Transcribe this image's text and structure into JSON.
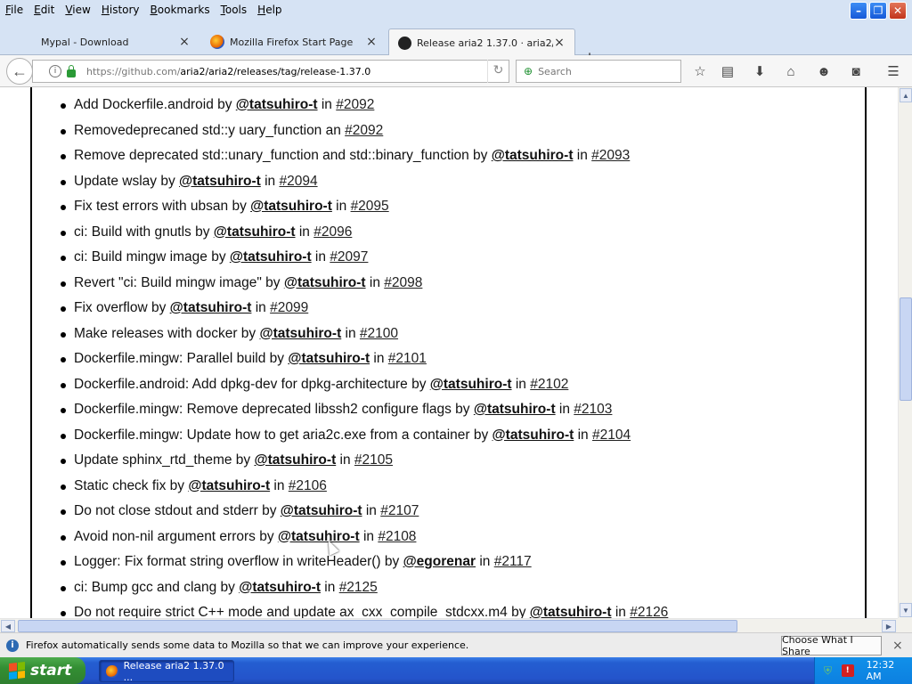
{
  "menubar": {
    "items": [
      "File",
      "Edit",
      "View",
      "History",
      "Bookmarks",
      "Tools",
      "Help"
    ]
  },
  "tabs": [
    {
      "label": "Mypal - Download",
      "close": "×"
    },
    {
      "label": "Mozilla Firefox Start Page",
      "close": "×"
    },
    {
      "label": "Release aria2 1.37.0 · aria2/...",
      "close": "×"
    }
  ],
  "newtab": "+",
  "address": {
    "prefix": "https://github.com/",
    "rest": "aria2/aria2/releases/tag/release-1.37.0"
  },
  "search": {
    "placeholder": "Search"
  },
  "items": [
    {
      "text": "Add Dockerfile.android by ",
      "author": "@tatsuhiro-t",
      "mid": " in ",
      "pr": "#2092"
    },
    {
      "text": "Removedeprecaned std::y uary_function an ",
      "author": "",
      "mid": "",
      "pr": "#2092"
    },
    {
      "text": "Remove deprecated std::unary_function and std::binary_function by ",
      "author": "@tatsuhiro-t",
      "mid": " in ",
      "pr": "#2093"
    },
    {
      "text": "Update wslay by ",
      "author": "@tatsuhiro-t",
      "mid": " in ",
      "pr": "#2094"
    },
    {
      "text": "Fix test errors with ubsan by ",
      "author": "@tatsuhiro-t",
      "mid": " in ",
      "pr": "#2095"
    },
    {
      "text": "ci: Build with gnutls by ",
      "author": "@tatsuhiro-t",
      "mid": " in ",
      "pr": "#2096"
    },
    {
      "text": "ci: Build mingw image by ",
      "author": "@tatsuhiro-t",
      "mid": " in ",
      "pr": "#2097"
    },
    {
      "text": "Revert \"ci: Build mingw image\" by ",
      "author": "@tatsuhiro-t",
      "mid": " in ",
      "pr": "#2098"
    },
    {
      "text": "Fix overflow by ",
      "author": "@tatsuhiro-t",
      "mid": " in ",
      "pr": "#2099"
    },
    {
      "text": "Make releases with docker by ",
      "author": "@tatsuhiro-t",
      "mid": " in ",
      "pr": "#2100"
    },
    {
      "text": "Dockerfile.mingw: Parallel build by ",
      "author": "@tatsuhiro-t",
      "mid": " in ",
      "pr": "#2101"
    },
    {
      "text": "Dockerfile.android: Add dpkg-dev for dpkg-architecture by ",
      "author": "@tatsuhiro-t",
      "mid": " in ",
      "pr": "#2102"
    },
    {
      "text": "Dockerfile.mingw: Remove deprecated libssh2 configure flags by ",
      "author": "@tatsuhiro-t",
      "mid": " in ",
      "pr": "#2103"
    },
    {
      "text": "Dockerfile.mingw: Update how to get aria2c.exe from a container by ",
      "author": "@tatsuhiro-t",
      "mid": " in ",
      "pr": "#2104"
    },
    {
      "text": "Update sphinx_rtd_theme by ",
      "author": "@tatsuhiro-t",
      "mid": " in ",
      "pr": "#2105"
    },
    {
      "text": "Static check fix by ",
      "author": "@tatsuhiro-t",
      "mid": " in ",
      "pr": "#2106"
    },
    {
      "text": "Do not close stdout and stderr by ",
      "author": "@tatsuhiro-t",
      "mid": " in ",
      "pr": "#2107"
    },
    {
      "text": "Avoid non-nil argument errors by ",
      "author": "@tatsuhiro-t",
      "mid": " in ",
      "pr": "#2108"
    },
    {
      "text": "Logger: Fix format string overflow in writeHeader() by ",
      "author": "@egorenar",
      "mid": " in ",
      "pr": "#2117"
    },
    {
      "text": "ci: Bump gcc and clang by ",
      "author": "@tatsuhiro-t",
      "mid": " in ",
      "pr": "#2125"
    },
    {
      "text": "Do not require strict C++ mode and update ax_cxx_compile_stdcxx.m4 by ",
      "author": "@tatsuhiro-t",
      "mid": " in ",
      "pr": "#2126"
    }
  ],
  "notification": {
    "text": "Firefox automatically sends some data to Mozilla so that we can improve your experience.",
    "button": "Choose What I Share",
    "close": "×"
  },
  "taskbar": {
    "start": "start",
    "window": "Release aria2 1.37.0 ...",
    "clock": "12:32 AM"
  }
}
